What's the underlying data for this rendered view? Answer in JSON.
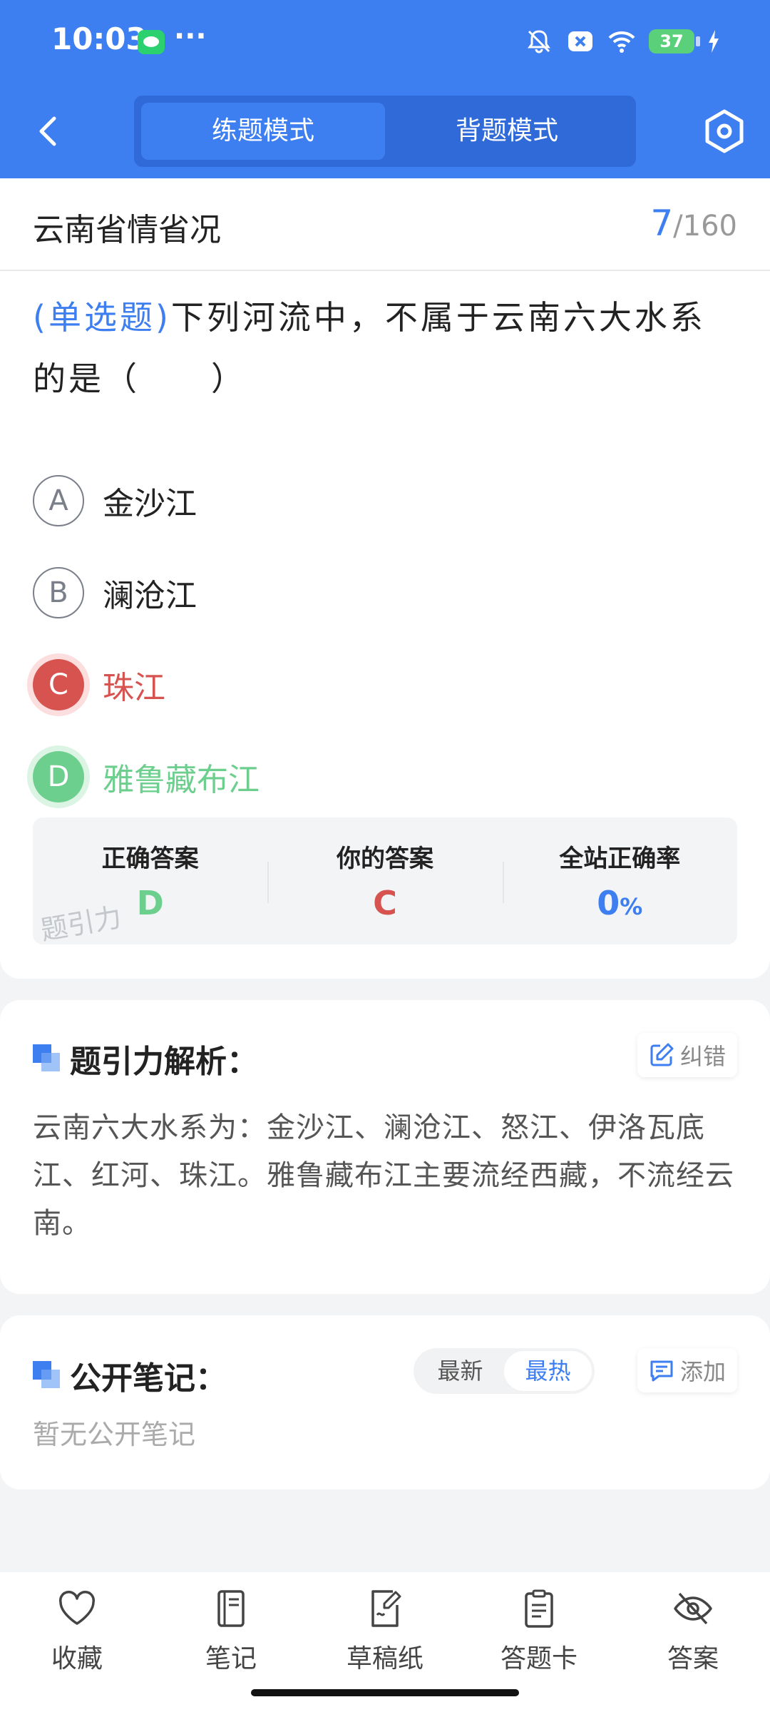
{
  "status_bar": {
    "time": "10:03",
    "more": "···",
    "battery": "37"
  },
  "header": {
    "tabs": [
      {
        "label": "练题模式",
        "active": true
      },
      {
        "label": "背题模式",
        "active": false
      }
    ]
  },
  "question_header": {
    "category": "云南省情省况",
    "current": "7",
    "total": "/160"
  },
  "question": {
    "type": "(单选题)",
    "text": "下列河流中，不属于云南六大水系的是（　　）"
  },
  "options": [
    {
      "letter": "A",
      "text": "金沙江",
      "state": "normal"
    },
    {
      "letter": "B",
      "text": "澜沧江",
      "state": "normal"
    },
    {
      "letter": "C",
      "text": "珠江",
      "state": "wrong"
    },
    {
      "letter": "D",
      "text": "雅鲁藏布江",
      "state": "correct"
    }
  ],
  "stats": {
    "correct_label": "正确答案",
    "correct_value": "D",
    "yours_label": "你的答案",
    "yours_value": "C",
    "rate_label": "全站正确率",
    "rate_value": "0",
    "rate_unit": "%",
    "watermark": "题引力"
  },
  "analysis": {
    "title": "题引力解析：",
    "report_label": "纠错",
    "text": "云南六大水系为：金沙江、澜沧江、怒江、伊洛瓦底江、红河、珠江。雅鲁藏布江主要流经西藏，不流经云南。"
  },
  "notes": {
    "title": "公开笔记：",
    "sort_tabs": [
      {
        "label": "最新",
        "active": false
      },
      {
        "label": "最热",
        "active": true
      }
    ],
    "add_label": "添加",
    "empty_text": "暂无公开笔记"
  },
  "bottom_nav": [
    {
      "label": "收藏",
      "icon": "heart-icon"
    },
    {
      "label": "笔记",
      "icon": "notebook-icon"
    },
    {
      "label": "草稿纸",
      "icon": "draft-paper-icon"
    },
    {
      "label": "答题卡",
      "icon": "answer-sheet-icon"
    },
    {
      "label": "答案",
      "icon": "eye-off-icon"
    }
  ],
  "colors": {
    "primary": "#3d7ef0",
    "wrong": "#d6534f",
    "correct": "#6ccf8d"
  }
}
